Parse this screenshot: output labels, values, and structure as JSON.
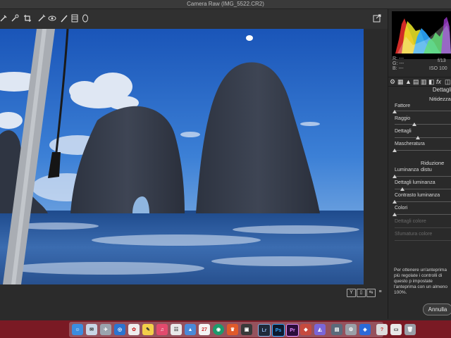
{
  "window": {
    "title": "Camera Raw (IMG_5522.CR2)"
  },
  "toolbar": {
    "tools": [
      "eyedropper-icon",
      "color-sampler-icon",
      "crop-icon",
      "brush-icon",
      "redeye-icon",
      "adjustment-brush-icon",
      "filter-icon",
      "radial-icon"
    ]
  },
  "histogram": {
    "r_label": "R:",
    "r_value": "---",
    "g_label": "G:",
    "g_value": "---",
    "b_label": "B:",
    "b_value": "---",
    "aperture": "f/13",
    "iso": "ISO 100"
  },
  "panel": {
    "title": "Dettagli",
    "sharpening": {
      "heading": "Nitidezza",
      "sliders": [
        {
          "label": "Fattore",
          "level": 0.0
        },
        {
          "label": "Raggio",
          "level": 0.34
        },
        {
          "label": "Dettagli",
          "level": 0.41
        },
        {
          "label": "Mascheratura",
          "level": 0.0
        }
      ]
    },
    "noise": {
      "heading": "Riduzione distu",
      "sliders": [
        {
          "label": "Luminanza",
          "level": 0.0
        },
        {
          "label": "Dettagli luminanza",
          "level": 0.14
        },
        {
          "label": "Contrasto luminanza",
          "level": 0.0
        },
        {
          "label": "Colori",
          "level": 0.0
        },
        {
          "label": "Dettagli colore",
          "level": null
        },
        {
          "label": "Sfumatura colore",
          "level": null
        }
      ]
    },
    "note": "Per ottenere un'anteprima più regolate i controlli di questo p impostate l'anteprima con un almeno 100%."
  },
  "buttons": {
    "cancel": "Annulla"
  },
  "statusbar": {
    "buttons": [
      "Y",
      "before-after-icon",
      "swap-icon",
      "settings-icon"
    ]
  },
  "dock": {
    "apps": [
      "Finder",
      "Mail",
      "Safari",
      "Foto",
      "Note",
      "Musica",
      "Keynote",
      "Calendario",
      "Lightroom",
      "Photoshop",
      "Premiere",
      "Anteprima",
      "Preferenze",
      "Help",
      "Cestino"
    ]
  }
}
